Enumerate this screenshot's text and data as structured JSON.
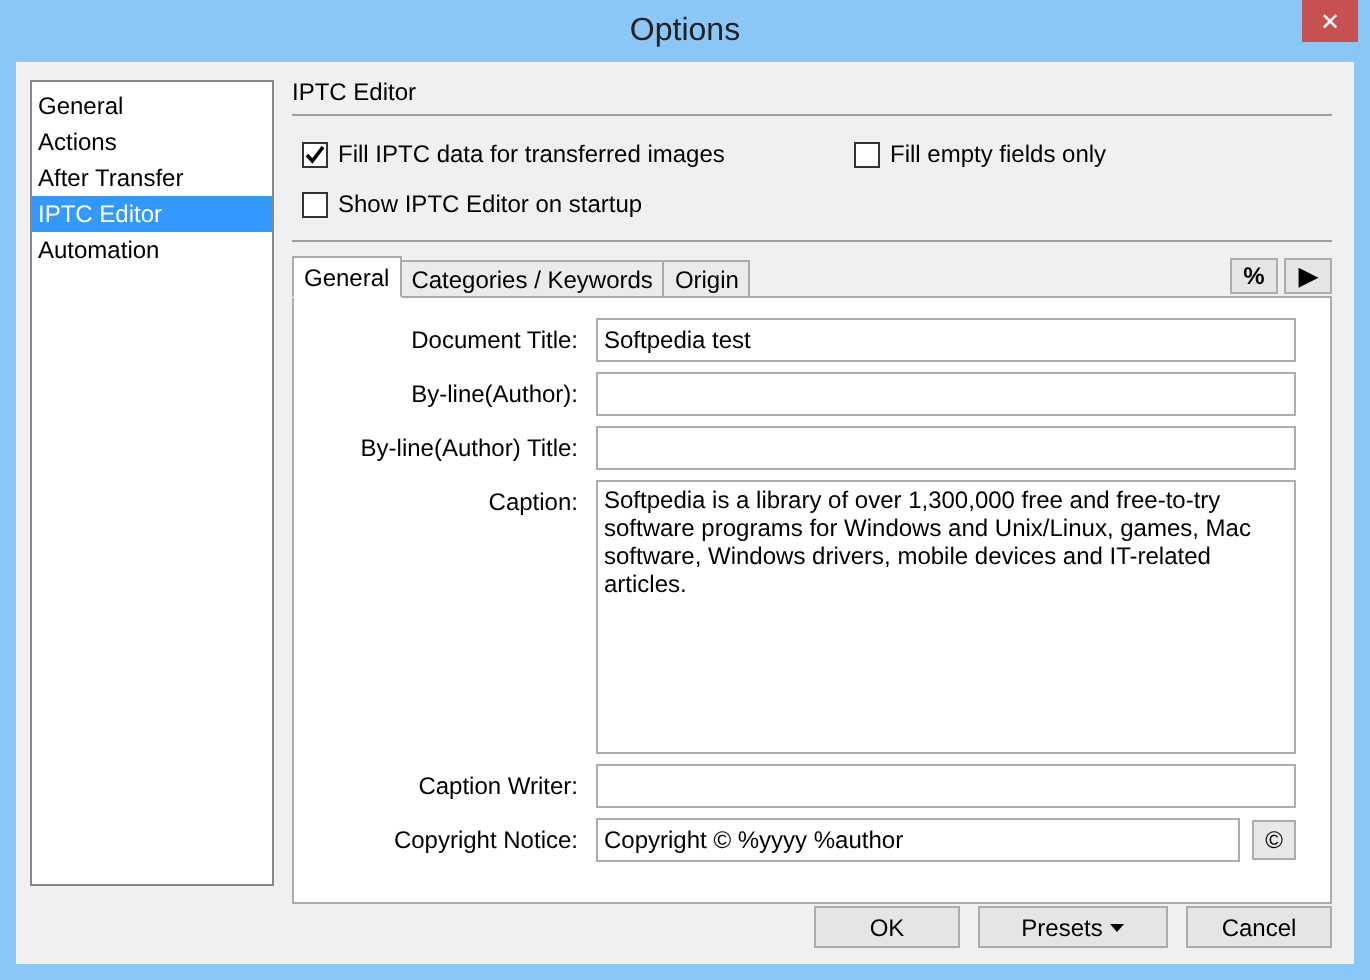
{
  "window": {
    "title": "Options",
    "close": "✕"
  },
  "sidebar": {
    "items": [
      {
        "label": "General",
        "selected": false
      },
      {
        "label": "Actions",
        "selected": false
      },
      {
        "label": "After Transfer",
        "selected": false
      },
      {
        "label": "IPTC Editor",
        "selected": true
      },
      {
        "label": "Automation",
        "selected": false
      }
    ]
  },
  "section_title": "IPTC Editor",
  "options": [
    {
      "label": "Fill IPTC data for transferred images",
      "checked": true
    },
    {
      "label": "Fill empty fields only",
      "checked": false
    },
    {
      "label": "Show IPTC Editor on startup",
      "checked": false
    }
  ],
  "tabs": [
    {
      "label": "General",
      "selected": true
    },
    {
      "label": "Categories / Keywords",
      "selected": false
    },
    {
      "label": "Origin",
      "selected": false
    }
  ],
  "tab_buttons": [
    "%",
    "▶"
  ],
  "fields": [
    {
      "kind": "line",
      "label": "Document Title:",
      "value": "Softpedia test"
    },
    {
      "kind": "line",
      "label": "By-line(Author):"
    },
    {
      "kind": "line",
      "label": "By-line(Author) Title:"
    },
    {
      "kind": "multiline",
      "label": "Caption:",
      "value": "Softpedia is a library of over 1,300,000 free and free-to-try software programs for Windows and Unix/Linux, games, Mac software, Windows drivers, mobile devices and IT-related articles."
    },
    {
      "kind": "line",
      "label": "Caption Writer:"
    },
    {
      "kind": "with-button",
      "label": "Copyright Notice:",
      "value": "Copyright © %yyyy %author",
      "button": "©"
    }
  ],
  "buttons": [
    {
      "label": "OK",
      "kind": "plain"
    },
    {
      "label": "Presets",
      "kind": "menu"
    },
    {
      "label": "Cancel",
      "kind": "plain"
    }
  ]
}
